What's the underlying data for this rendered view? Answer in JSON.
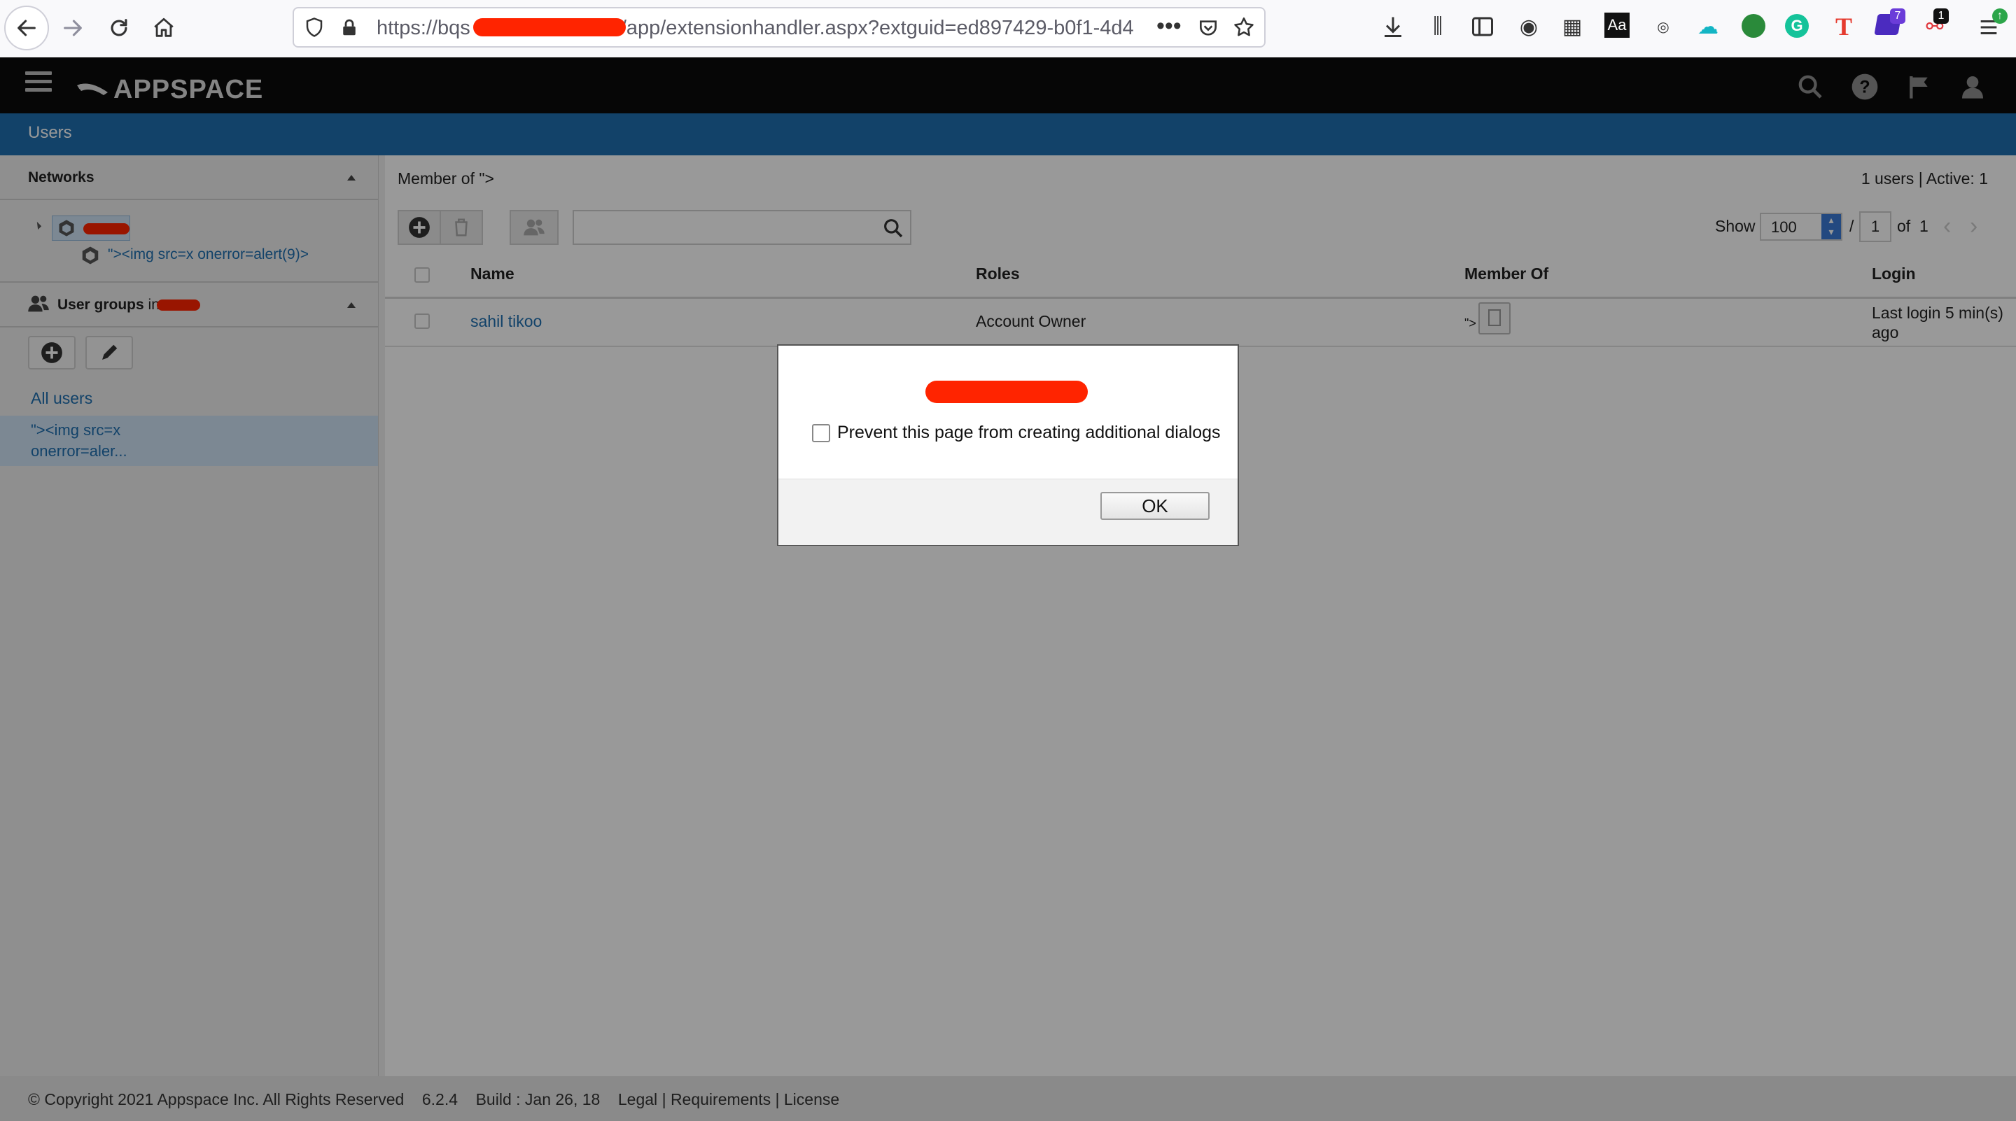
{
  "browser": {
    "url_prefix": "https://bqs",
    "url_suffix": "/app/extensionhandler.aspx?extguid=ed897429-b0f1-4d4",
    "badge_extension_7": "7",
    "badge_extension_1": "1"
  },
  "app": {
    "logo": "APPSPACE",
    "page_title": "Users"
  },
  "sidebar": {
    "networks_title": "Networks",
    "network_child": "\"><img src=x onerror=alert(9)>",
    "user_groups_title": "User groups",
    "user_groups_in": "in",
    "all_users": "All users",
    "selected_group_line1": "\"><img src=x",
    "selected_group_line2": "onerror=aler..."
  },
  "main": {
    "breadcrumb": "Member of \">",
    "summary": "1 users | Active: 1",
    "show_label": "Show",
    "page_size": "100",
    "page_sep": "/",
    "page_current": "1",
    "of_label": "of",
    "page_total": "1",
    "columns": {
      "name": "Name",
      "roles": "Roles",
      "member_of": "Member Of",
      "login": "Login"
    },
    "rows": [
      {
        "name": "sahil tikoo",
        "role": "Account Owner",
        "member_of": "\">",
        "login_line1": "Last login 5 min(s)",
        "login_line2": "ago"
      }
    ]
  },
  "footer": {
    "copyright": "© Copyright 2021 Appspace Inc. All Rights Reserved",
    "version": "6.2.4",
    "build": "Build : Jan 26, 18",
    "legal": "Legal",
    "requirements": "Requirements",
    "license": "License",
    "sep": "|"
  },
  "dialog": {
    "checkbox_label": "Prevent this page from creating additional dialogs",
    "ok_label": "OK"
  },
  "colors": {
    "accent_blue": "#1e6fb0",
    "header_black": "#0a0a0a",
    "redaction_red": "#ff2400"
  }
}
